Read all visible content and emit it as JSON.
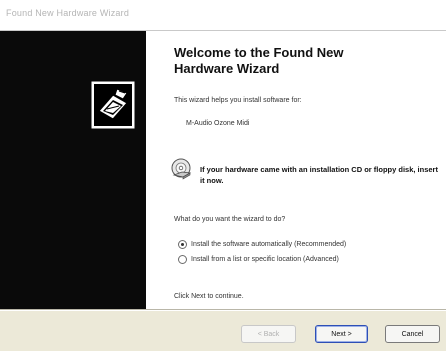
{
  "window": {
    "title": "Found New Hardware Wizard"
  },
  "icons": {
    "hardware": "hardware-install-icon",
    "cd": "cd-install-icon"
  },
  "main": {
    "heading": "Welcome to the Found New Hardware Wizard",
    "intro": "This wizard helps you install software for:",
    "device": "M-Audio Ozone Midi",
    "cd_text": "If your hardware came with an installation CD or floppy disk, insert it now.",
    "question": "What do you want the wizard to do?",
    "options": [
      {
        "label": "Install the software automatically (Recommended)",
        "selected": true
      },
      {
        "label": "Install from a list or specific location (Advanced)",
        "selected": false
      }
    ],
    "continue_text": "Click Next to continue."
  },
  "buttons": {
    "back": "< Back",
    "next": "Next >",
    "cancel": "Cancel"
  },
  "colors": {
    "side_panel": "#0a0a0a",
    "dialog_face": "#ece9d8",
    "default_button_border": "#2e4fb5"
  }
}
